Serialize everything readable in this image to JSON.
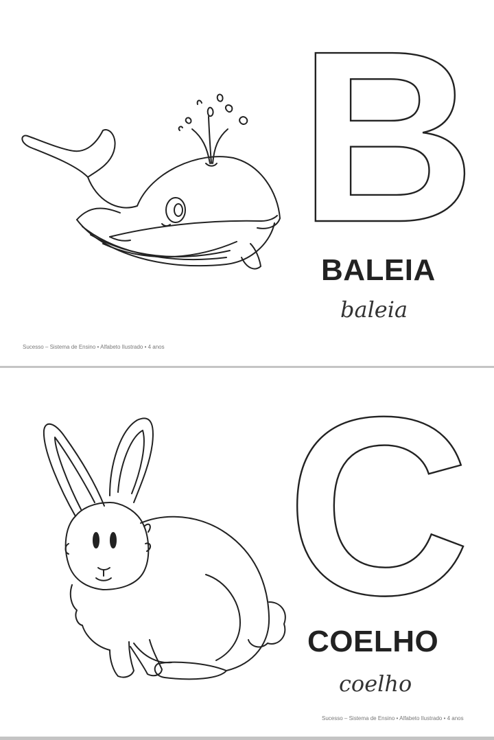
{
  "pages": [
    {
      "letter": "B",
      "word": "BALEIA",
      "word_cursive": "baleia",
      "image": "whale",
      "footer": "Sucesso – Sistema de Ensino • Alfabeto Ilustrado • 4 anos"
    },
    {
      "letter": "C",
      "word": "COELHO",
      "word_cursive": "coelho",
      "image": "rabbit",
      "footer": "Sucesso – Sistema de Ensino • Alfabeto Ilustrado • 4 anos"
    }
  ],
  "colors": {
    "line": "#222222",
    "divider": "#c4c4c4",
    "footer_text": "#777777"
  }
}
